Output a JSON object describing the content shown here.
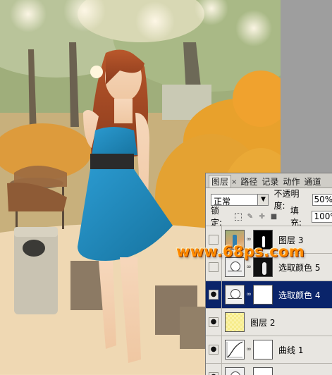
{
  "panel": {
    "tabs": [
      {
        "label": "图层",
        "active": true
      },
      {
        "label": "路径",
        "active": false
      },
      {
        "label": "记录",
        "active": false
      },
      {
        "label": "动作",
        "active": false
      },
      {
        "label": "通道",
        "active": false
      }
    ],
    "tab_close": "×",
    "blend_mode": "正常",
    "opacity_label": "不透明度:",
    "opacity_value": "50%",
    "lock_label": "锁定:",
    "fill_label": "填充:",
    "fill_value": "100%",
    "layers": [
      {
        "name": "图层 3",
        "visible": false,
        "selected": false
      },
      {
        "name": "选取颜色 5",
        "visible": false,
        "selected": false
      },
      {
        "name": "选取颜色 4",
        "visible": true,
        "selected": true
      },
      {
        "name": "图层 2",
        "visible": true,
        "selected": false
      },
      {
        "name": "曲线 1",
        "visible": true,
        "selected": false
      },
      {
        "name": "",
        "visible": true,
        "selected": false
      }
    ]
  },
  "watermark": "www.68ps.com",
  "colors": {
    "selection": "#0a246a",
    "watermark": "#ff8a00",
    "dress": "#1f86b8"
  }
}
